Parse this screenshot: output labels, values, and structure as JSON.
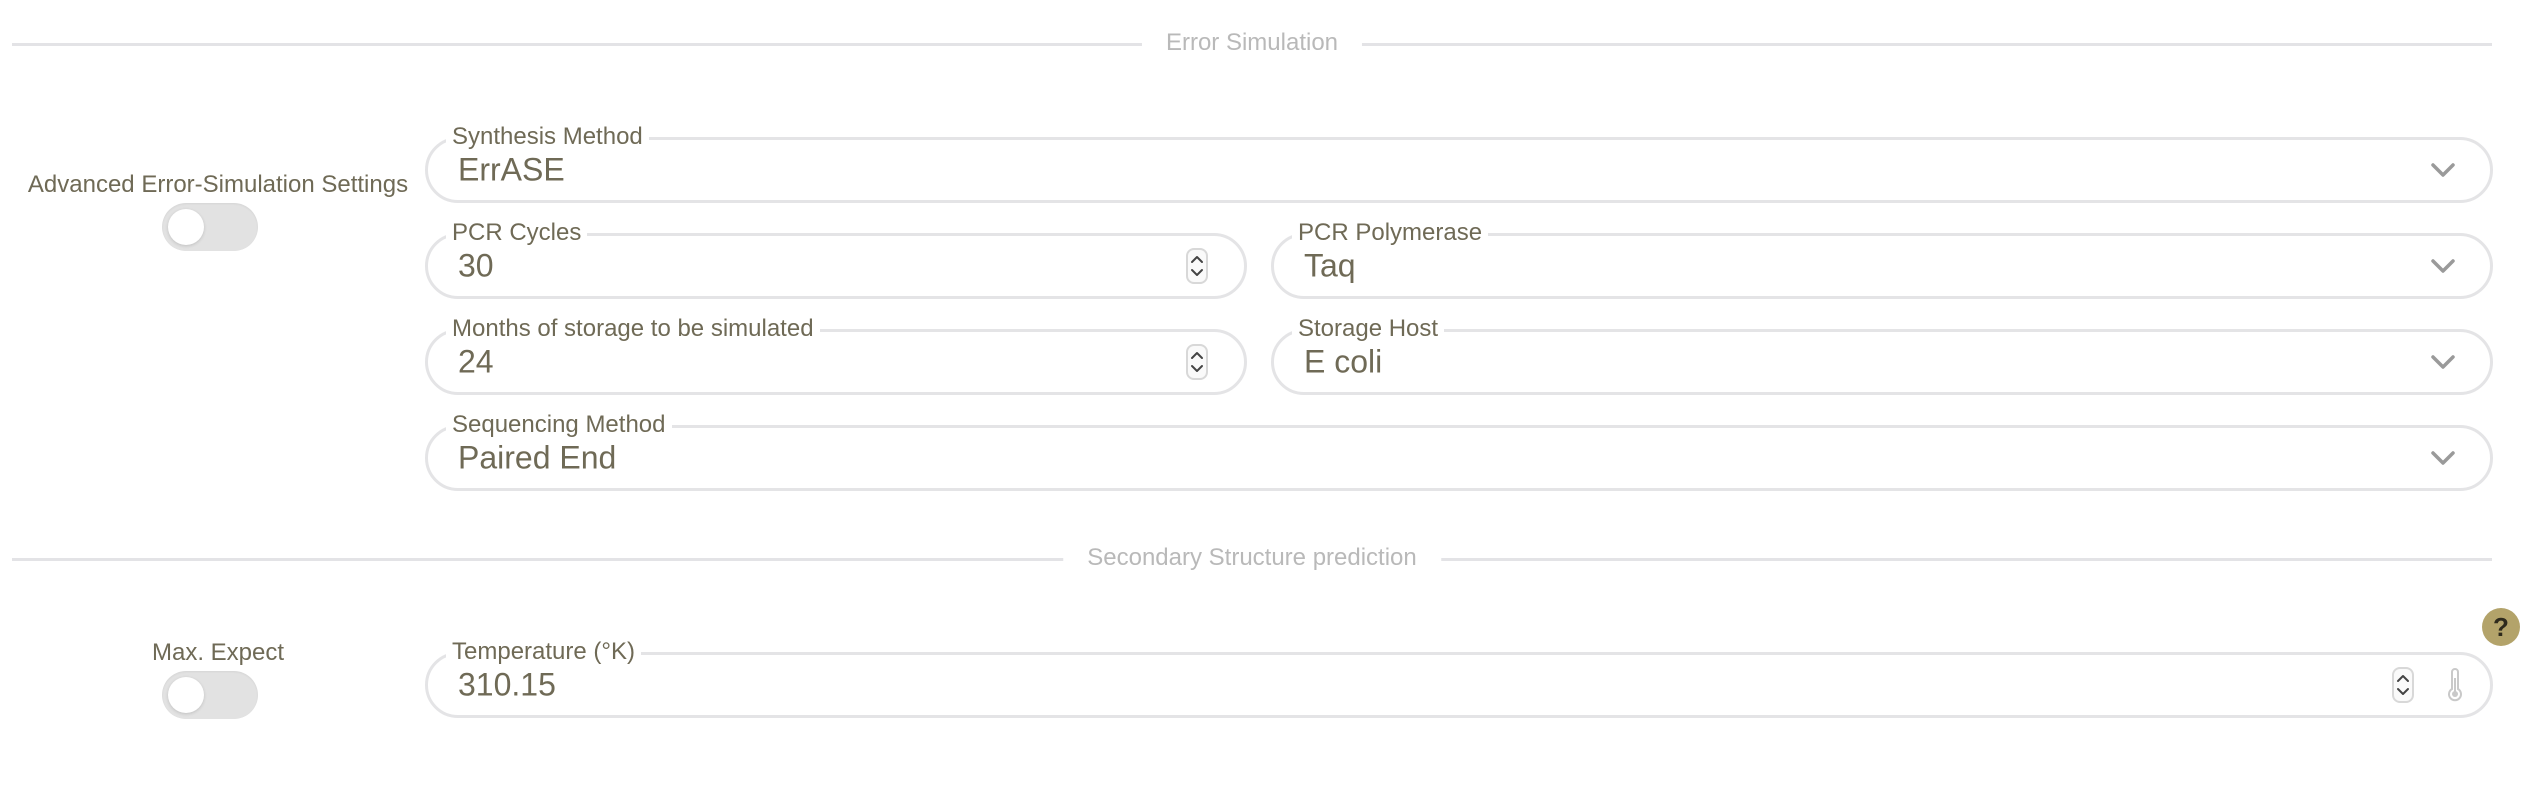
{
  "sections": {
    "error_simulation": "Error Simulation",
    "secondary_structure": "Secondary Structure prediction"
  },
  "advanced_settings": {
    "label": "Advanced Error-Simulation Settings",
    "enabled": false
  },
  "fields": {
    "synthesis_method": {
      "label": "Synthesis Method",
      "value": "ErrASE"
    },
    "pcr_cycles": {
      "label": "PCR Cycles",
      "value": "30"
    },
    "pcr_polymerase": {
      "label": "PCR Polymerase",
      "value": "Taq"
    },
    "storage_months": {
      "label": "Months of storage to be simulated",
      "value": "24"
    },
    "storage_host": {
      "label": "Storage Host",
      "value": "E coli"
    },
    "sequencing_method": {
      "label": "Sequencing Method",
      "value": "Paired End"
    },
    "temperature": {
      "label": "Temperature (°K)",
      "value": "310.15"
    }
  },
  "max_expect": {
    "label": "Max. Expect",
    "enabled": false
  },
  "help_button": "?",
  "icons": {
    "dropdown": "chevron-down-icon",
    "stepper": "spinner-arrows-icon",
    "temperature": "thermometer-icon"
  },
  "colors": {
    "text": "#6f6a56",
    "section_title": "#b9b9b9",
    "border": "#e4e4e6",
    "toggle_off": "#e2e2e2",
    "help_bg": "#b3a36a"
  }
}
